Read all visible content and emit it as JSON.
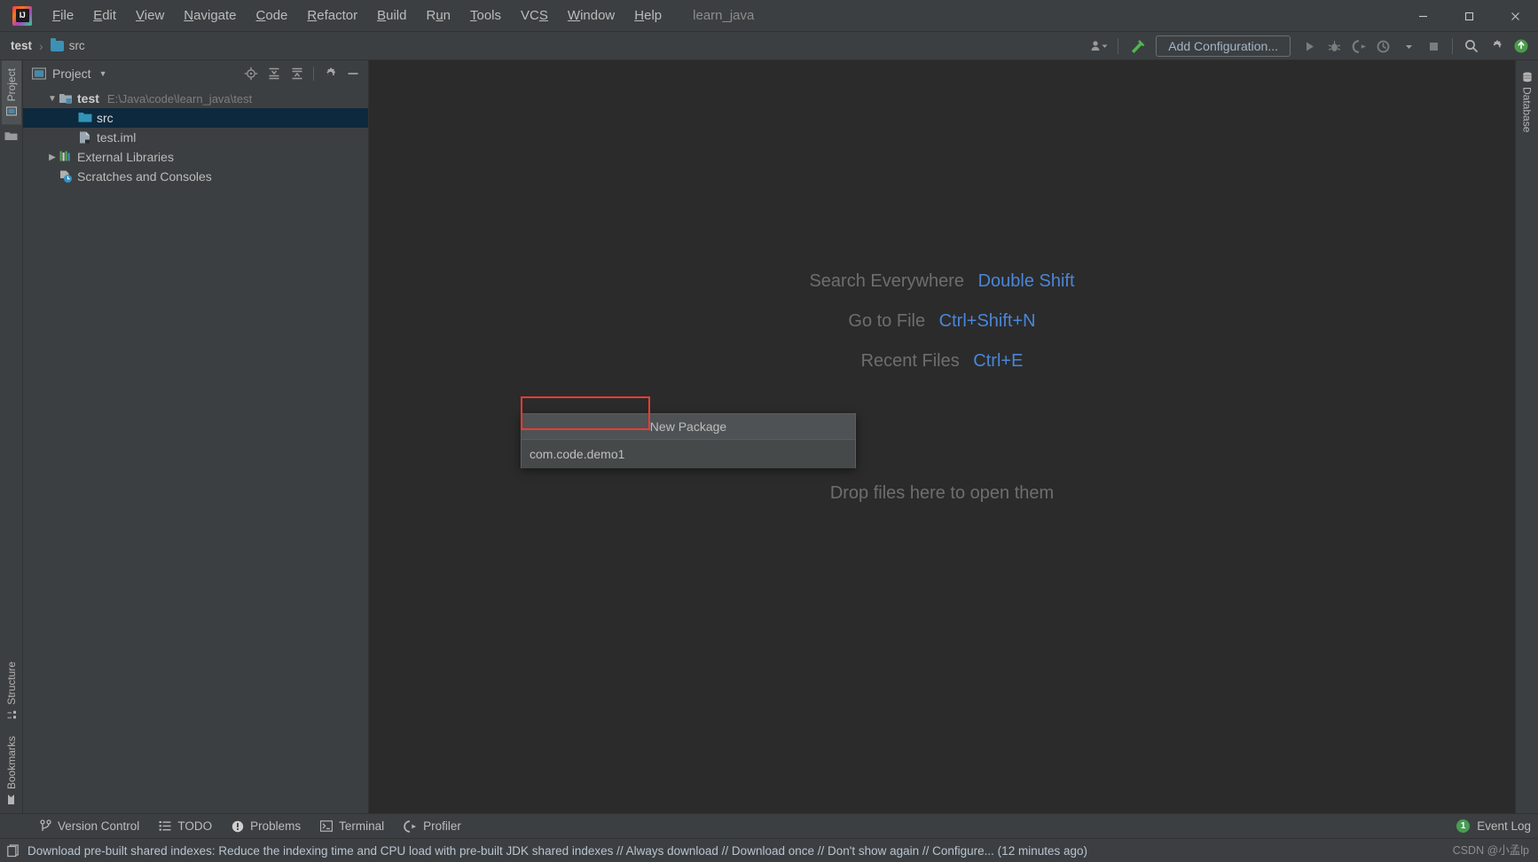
{
  "window": {
    "title": "learn_java",
    "controls": {
      "minimize": "minimize-icon",
      "maximize": "maximize-icon",
      "close": "close-icon"
    }
  },
  "menubar": {
    "items": [
      {
        "label": "File",
        "mnemonic": "F"
      },
      {
        "label": "Edit",
        "mnemonic": "E"
      },
      {
        "label": "View",
        "mnemonic": "V"
      },
      {
        "label": "Navigate",
        "mnemonic": "N"
      },
      {
        "label": "Code",
        "mnemonic": "C"
      },
      {
        "label": "Refactor",
        "mnemonic": "R"
      },
      {
        "label": "Build",
        "mnemonic": "B"
      },
      {
        "label": "Run",
        "mnemonic": "u"
      },
      {
        "label": "Tools",
        "mnemonic": "T"
      },
      {
        "label": "VCS",
        "mnemonic": "S"
      },
      {
        "label": "Window",
        "mnemonic": "W"
      },
      {
        "label": "Help",
        "mnemonic": "H"
      }
    ]
  },
  "navbar": {
    "breadcrumb": {
      "project": "test",
      "separator": "›",
      "folder": "src"
    },
    "add_configuration": "Add Configuration...",
    "icons": [
      "user-dropdown-icon",
      "hammer-build-icon",
      "run-icon",
      "debug-icon",
      "run-with-coverage-icon",
      "profile-icon",
      "profile-dropdown-icon",
      "stop-icon",
      "search-icon",
      "settings-gear-icon",
      "updates-icon"
    ]
  },
  "left_strip": {
    "tabs": [
      {
        "label": "Project",
        "icon": "project-icon",
        "active": true
      },
      {
        "label": "Structure",
        "icon": "structure-icon",
        "active": false
      },
      {
        "label": "Bookmarks",
        "icon": "bookmark-icon",
        "active": false
      }
    ]
  },
  "right_strip": {
    "tabs": [
      {
        "label": "Database",
        "icon": "database-icon",
        "active": false
      }
    ]
  },
  "project_panel": {
    "title": "Project",
    "actions": [
      "locate-icon",
      "expand-all-icon",
      "collapse-all-icon",
      "settings-gear-icon",
      "hide-icon"
    ],
    "tree": [
      {
        "label": "test",
        "path": "E:\\Java\\code\\learn_java\\test",
        "icon": "module-folder-icon",
        "arrow": "expanded",
        "depth": 0,
        "bold": true,
        "selected": false
      },
      {
        "label": "src",
        "path": "",
        "icon": "source-folder-icon",
        "arrow": "none",
        "depth": 1,
        "bold": false,
        "selected": true
      },
      {
        "label": "test.iml",
        "path": "",
        "icon": "iml-file-icon",
        "arrow": "none",
        "depth": 1,
        "bold": false,
        "selected": false
      },
      {
        "label": "External Libraries",
        "path": "",
        "icon": "libraries-icon",
        "arrow": "collapsed",
        "depth": 0,
        "bold": false,
        "selected": false
      },
      {
        "label": "Scratches and Consoles",
        "path": "",
        "icon": "scratches-icon",
        "arrow": "none",
        "depth": 0,
        "bold": false,
        "selected": false
      }
    ]
  },
  "editor": {
    "hints": [
      {
        "action": "Search Everywhere",
        "shortcut": "Double Shift"
      },
      {
        "action": "Go to File",
        "shortcut": "Ctrl+Shift+N"
      },
      {
        "action": "Recent Files",
        "shortcut": "Ctrl+E"
      }
    ],
    "drop_hint": "Drop files here to open them"
  },
  "popup": {
    "title": "New Package",
    "input_value": "com.code.demo1",
    "input_placeholder": "",
    "highlight_color": "#ee3b33"
  },
  "toolwindow_bar": {
    "items": [
      {
        "label": "Version Control",
        "icon": "branch-icon"
      },
      {
        "label": "TODO",
        "icon": "todo-list-icon"
      },
      {
        "label": "Problems",
        "icon": "problems-icon"
      },
      {
        "label": "Terminal",
        "icon": "terminal-icon"
      },
      {
        "label": "Profiler",
        "icon": "profiler-icon"
      }
    ],
    "event_log": {
      "label": "Event Log",
      "count": "1",
      "badge_color": "#499c54"
    }
  },
  "statusbar": {
    "icon": "indexes-icon",
    "message": "Download pre-built shared indexes: Reduce the indexing time and CPU load with pre-built JDK shared indexes // Always download // Download once // Don't show again // Configure... (12 minutes ago)",
    "watermark": "CSDN @小孟lp"
  }
}
